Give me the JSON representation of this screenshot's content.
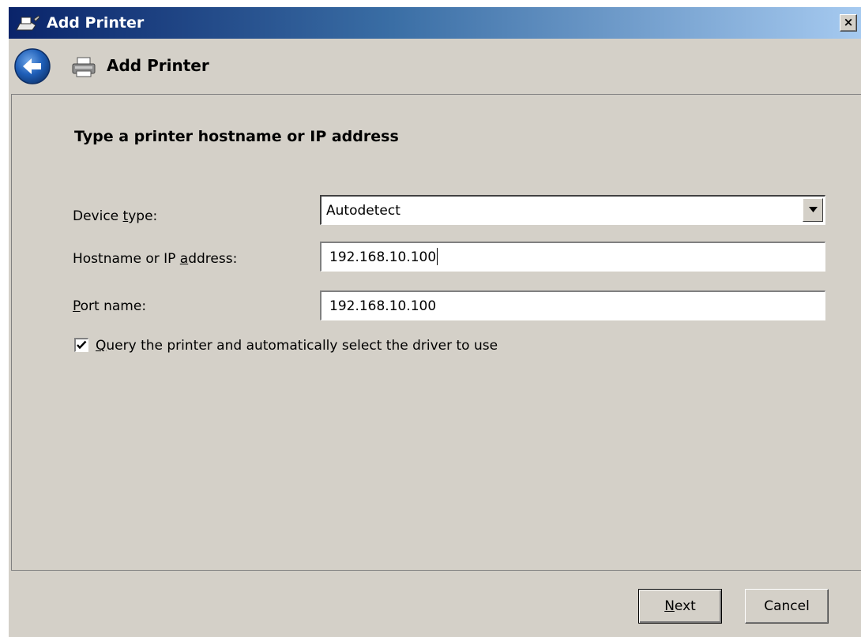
{
  "window": {
    "title": "Add Printer",
    "close_label": "×",
    "colors": {
      "titlebar_start": "#0a246a",
      "titlebar_end": "#a6caf0",
      "face": "#d4d0c8"
    }
  },
  "navbar": {
    "back_icon": "back-arrow-icon",
    "title": "Add Printer",
    "icon": "printer-icon"
  },
  "main": {
    "heading": "Type a printer hostname or IP address",
    "device_type": {
      "label_pre": "Device ",
      "label_accel": "t",
      "label_post": "ype:",
      "value": "Autodetect"
    },
    "hostname": {
      "label_pre": "Hostname or IP ",
      "label_accel": "a",
      "label_post": "ddress:",
      "value": "192.168.10.100"
    },
    "port": {
      "label_pre": "",
      "label_accel": "P",
      "label_post": "ort name:",
      "value": "192.168.10.100"
    },
    "query_checkbox": {
      "checked": true,
      "label_accel": "Q",
      "label_post": "uery the printer and automatically select the driver to use"
    }
  },
  "footer": {
    "next": {
      "accel": "N",
      "post": "ext"
    },
    "cancel": "Cancel"
  }
}
